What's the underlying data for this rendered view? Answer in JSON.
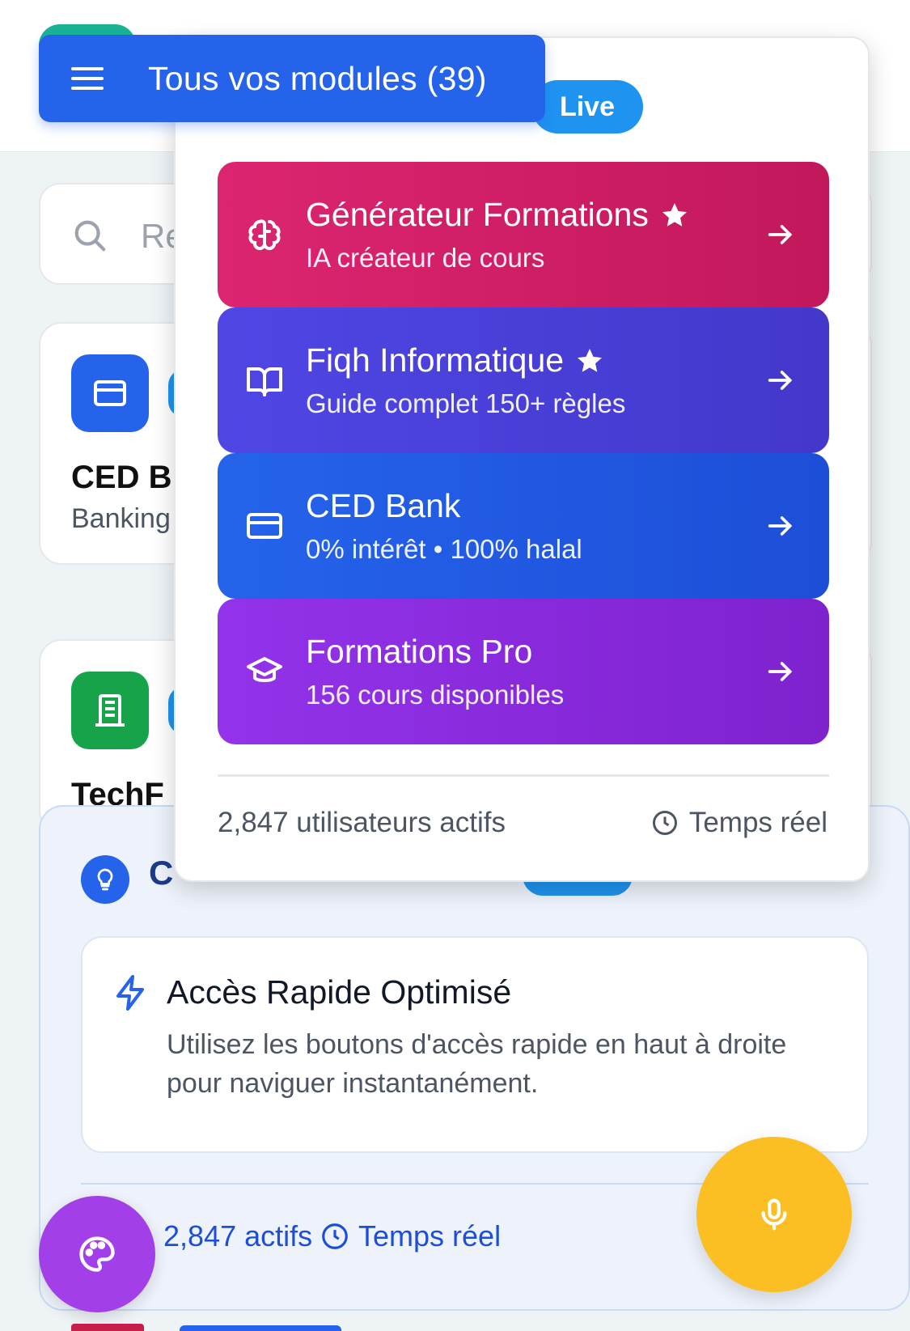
{
  "header": {
    "modules_button_label": "Tous vos modules (39)",
    "live_badge": "Live"
  },
  "search": {
    "placeholder_visible": "Re"
  },
  "background_cards": [
    {
      "title": "CED B",
      "subtitle": "Banking"
    },
    {
      "title": "TechF",
      "subtitle": ""
    }
  ],
  "modules": [
    {
      "title": "Générateur Formations",
      "subtitle": "IA créateur de cours",
      "starred": true,
      "icon": "brain-icon",
      "color": "#d81b60"
    },
    {
      "title": "Fiqh Informatique",
      "subtitle": "Guide complet 150+ règles",
      "starred": true,
      "icon": "book-icon",
      "color": "#4338ca"
    },
    {
      "title": "CED Bank",
      "subtitle": "0% intérêt • 100% halal",
      "starred": false,
      "icon": "credit-card-icon",
      "color": "#1d4ed8"
    },
    {
      "title": "Formations Pro",
      "subtitle": "156 cours disponibles",
      "starred": false,
      "icon": "graduation-cap-icon",
      "color": "#8b2be0"
    }
  ],
  "dropdown_footer": {
    "users": "2,847 utilisateurs actifs",
    "realtime": "Temps réel"
  },
  "tips": {
    "card_heading": "Accès Rapide Optimisé",
    "card_body": "Utilisez les boutons d'accès rapide en haut à droite pour naviguer instantanément.",
    "footer_active": "2,847 actifs",
    "footer_realtime": "Temps réel"
  },
  "colors": {
    "primary": "#2563eb",
    "live": "#1e93f0",
    "fab_palette": "#a23fe8",
    "fab_mic": "#fbbf24"
  }
}
